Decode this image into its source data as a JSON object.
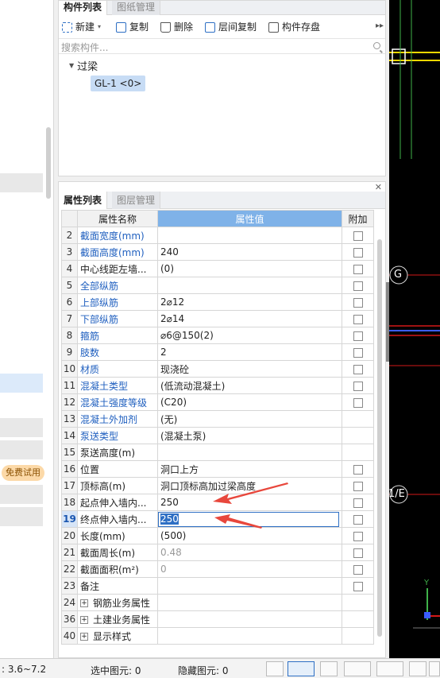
{
  "component_panel": {
    "tabs": [
      "构件列表",
      "图纸管理"
    ],
    "toolbar": {
      "new_label": "新建",
      "copy_label": "复制",
      "delete_label": "删除",
      "floor_copy_label": "层间复制",
      "save_label": "构件存盘"
    },
    "search_placeholder": "搜索构件...",
    "tree": {
      "root": "过梁",
      "child": "GL-1 <0>"
    }
  },
  "left_panel": {
    "trial_badge": "免费试用"
  },
  "property_panel": {
    "tabs": [
      "属性列表",
      "图层管理"
    ],
    "columns": [
      "属性名称",
      "属性值",
      "附加"
    ],
    "rows": [
      {
        "no": "2",
        "name": "截面宽度(mm)",
        "value": "",
        "checkbox": true
      },
      {
        "no": "3",
        "name": "截面高度(mm)",
        "value": "240",
        "checkbox": true
      },
      {
        "no": "4",
        "name": "中心线距左墙...",
        "value": "(0)",
        "checkbox": true
      },
      {
        "no": "5",
        "name": "全部纵筋",
        "value": "",
        "checkbox": true
      },
      {
        "no": "6",
        "name": "上部纵筋",
        "value": "2⌀12",
        "checkbox": true
      },
      {
        "no": "7",
        "name": "下部纵筋",
        "value": "2⌀14",
        "checkbox": true
      },
      {
        "no": "8",
        "name": "箍筋",
        "value": "⌀6@150(2)",
        "checkbox": true
      },
      {
        "no": "9",
        "name": "肢数",
        "value": "2",
        "checkbox": true
      },
      {
        "no": "10",
        "name": "材质",
        "value": "现浇砼",
        "checkbox": true
      },
      {
        "no": "11",
        "name": "混凝土类型",
        "value": "(低流动混凝土)",
        "checkbox": true
      },
      {
        "no": "12",
        "name": "混凝土强度等级",
        "value": "(C20)",
        "checkbox": true
      },
      {
        "no": "13",
        "name": "混凝土外加剂",
        "value": "(无)",
        "checkbox": false
      },
      {
        "no": "14",
        "name": "泵送类型",
        "value": "(混凝土泵)",
        "checkbox": false
      },
      {
        "no": "15",
        "name": "泵送高度(m)",
        "value": "",
        "checkbox": false
      },
      {
        "no": "16",
        "name": "位置",
        "value": "洞口上方",
        "checkbox": true
      },
      {
        "no": "17",
        "name": "顶标高(m)",
        "value": "洞口顶标高加过梁高度",
        "checkbox": true
      },
      {
        "no": "18",
        "name": "起点伸入墙内...",
        "value": "250",
        "checkbox": true
      },
      {
        "no": "19",
        "name": "终点伸入墙内...",
        "value": "250",
        "checkbox": true
      },
      {
        "no": "20",
        "name": "长度(mm)",
        "value": "(500)",
        "checkbox": true
      },
      {
        "no": "21",
        "name": "截面周长(m)",
        "value": "0.48",
        "checkbox": true
      },
      {
        "no": "22",
        "name": "截面面积(m²)",
        "value": "0",
        "checkbox": true
      },
      {
        "no": "23",
        "name": "备注",
        "value": "",
        "checkbox": true
      },
      {
        "no": "24",
        "name": "钢筋业务属性",
        "value": "",
        "checkbox": false
      },
      {
        "no": "36",
        "name": "土建业务属性",
        "value": "",
        "checkbox": false
      },
      {
        "no": "40",
        "name": "显示样式",
        "value": "",
        "checkbox": false
      }
    ]
  },
  "canvas": {
    "axis_labels": [
      "G",
      "1/E"
    ],
    "y_axis_label": "Y"
  },
  "status_bar": {
    "range": ": 3.6~7.2",
    "selected": "选中图元: 0",
    "hidden": "隐藏图元: 0"
  },
  "colors": {
    "accent": "#2e6fc4",
    "header_value_bg": "#7fb2e8",
    "annotation_arrow": "#e8473c"
  }
}
